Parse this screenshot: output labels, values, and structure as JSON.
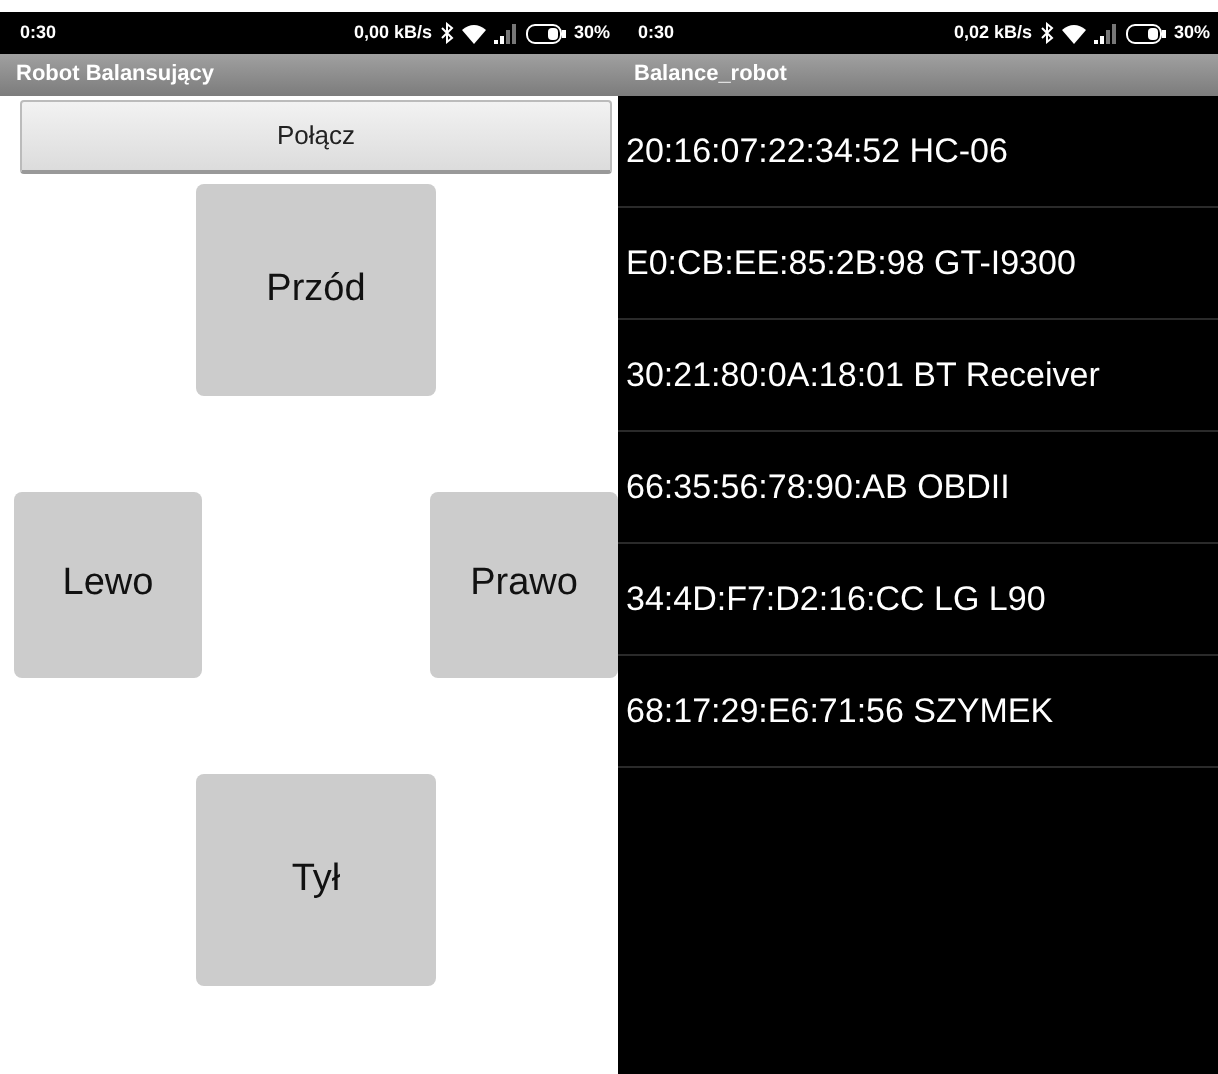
{
  "screens": [
    {
      "status_bar": {
        "time": "0:30",
        "speed": "0,00 kB/s",
        "battery": "30%"
      },
      "title": "Robot Balansujący",
      "connect_button": "Połącz",
      "controls": {
        "forward": "Przód",
        "left": "Lewo",
        "right": "Prawo",
        "back": "Tył"
      }
    },
    {
      "status_bar": {
        "time": "0:30",
        "speed": "0,02 kB/s",
        "battery": "30%"
      },
      "title": "Balance_robot",
      "devices": [
        "20:16:07:22:34:52 HC-06",
        "E0:CB:EE:85:2B:98 GT-I9300",
        "30:21:80:0A:18:01 BT Receiver",
        "66:35:56:78:90:AB OBDII",
        "34:4D:F7:D2:16:CC LG L90",
        "68:17:29:E6:71:56 SZYMEK"
      ]
    }
  ]
}
